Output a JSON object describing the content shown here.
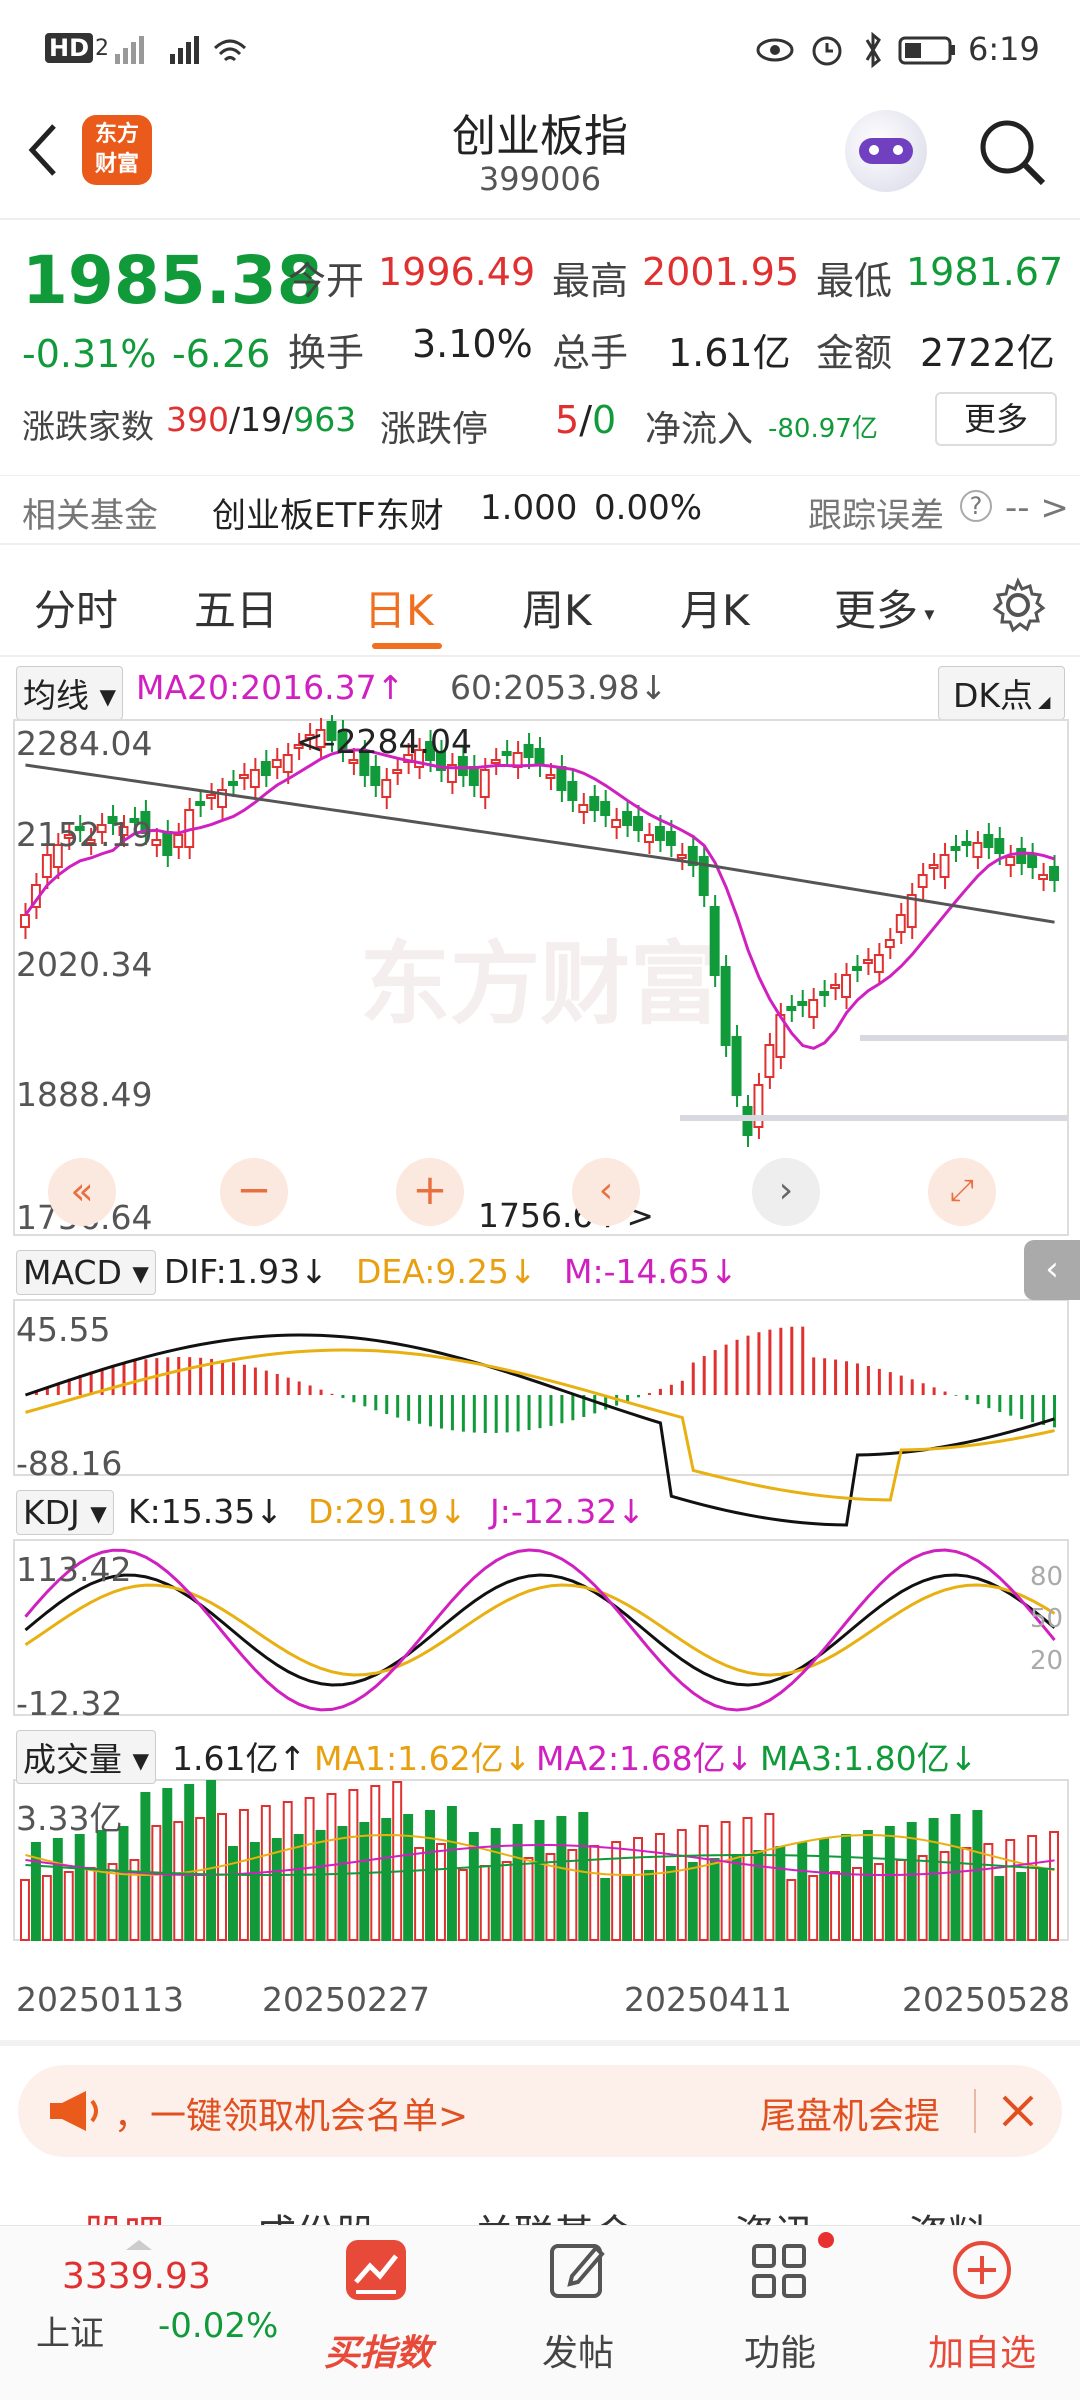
{
  "status_bar": {
    "left_icons": "HD 2 5G",
    "time": "6:19"
  },
  "header": {
    "title": "创业板指",
    "code": "399006",
    "logo_text": "东方财富"
  },
  "quote": {
    "price": "1985.38",
    "change_pct": "-0.31%",
    "change": "-6.26",
    "open_label": "今开",
    "open": "1996.49",
    "high_label": "最高",
    "high": "2001.95",
    "low_label": "最低",
    "low": "1981.67",
    "turnover_label": "换手",
    "turnover": "3.10%",
    "volume_label": "总手",
    "volume": "1.61亿",
    "amount_label": "金额",
    "amount": "2722亿",
    "breadth_label": "涨跌家数",
    "breadth_up": "390",
    "breadth_flat": "19",
    "breadth_down": "963",
    "limit_label": "涨跌停",
    "limit_up": "5",
    "limit_down": "0",
    "netflow_label": "净流入",
    "netflow": "-80.97亿",
    "more_button": "更多"
  },
  "fund": {
    "label": "相关基金",
    "name": "创业板ETF东财",
    "nav": "1.000",
    "pct": "0.00%",
    "tracking_label": "跟踪误差",
    "tracking_value": "-- >"
  },
  "tabs": [
    "分时",
    "五日",
    "日K",
    "周K",
    "月K",
    "更多"
  ],
  "main_chart": {
    "indicator_select": "均线",
    "ma20": "MA20:2016.37",
    "ma60": "60:2053.98",
    "dk_button": "DK点",
    "y_labels": [
      "2284.04",
      "2152.19",
      "2020.34",
      "1888.49",
      "1756.64"
    ],
    "max_marker": "<-2284.04",
    "min_marker": "1756.64->",
    "watermark": "东方财富"
  },
  "macd": {
    "select": "MACD",
    "dif": "DIF:1.93",
    "dea": "DEA:9.25",
    "m": "M:-14.65",
    "y_top": "45.55",
    "y_bottom": "-88.16"
  },
  "kdj": {
    "select": "KDJ",
    "k": "K:15.35",
    "d": "D:29.19",
    "j": "J:-12.32",
    "y_top": "113.42",
    "y_bottom": "-12.32",
    "levels": [
      "80",
      "50",
      "20"
    ]
  },
  "volume": {
    "select": "成交量",
    "vol": "1.61亿",
    "ma1": "MA1:1.62亿",
    "ma2": "MA2:1.68亿",
    "ma3": "MA3:1.80亿",
    "y_top": "3.33亿"
  },
  "x_dates": [
    "20250113",
    "20250227",
    "20250411",
    "20250528"
  ],
  "banner": {
    "text": "，一键领取机会名单>",
    "right_text": "尾盘机会提"
  },
  "sub_tabs": [
    "股吧",
    "成份股",
    "关联基金",
    "资讯",
    "资料"
  ],
  "bottom_bar": {
    "index_price": "3339.93",
    "index_name": "上证",
    "index_pct": "-0.02%",
    "buy_label": "买指数",
    "post_label": "发帖",
    "func_label": "功能",
    "add_label": "加自选"
  },
  "colors": {
    "up": "#e03030",
    "down": "#109a3a",
    "accent": "#f07020",
    "ma20": "#d020c0",
    "ma60": "#555555",
    "dea": "#e8b010"
  }
}
